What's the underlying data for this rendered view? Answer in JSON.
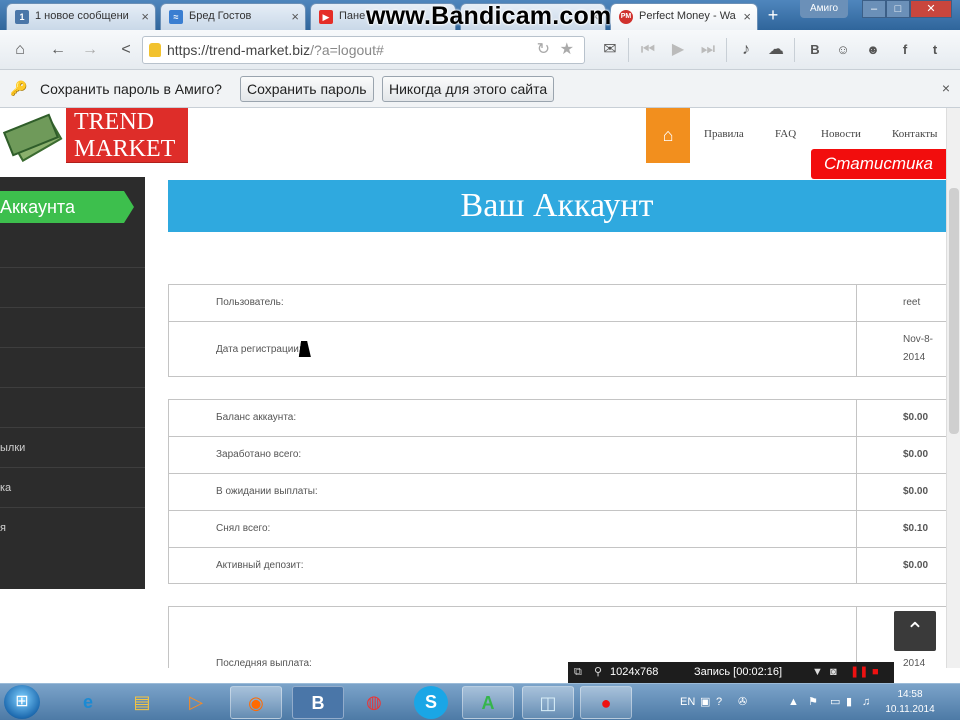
{
  "browser": {
    "tabs": [
      {
        "title": "1 новое сообщени",
        "favicon": "1",
        "color": "#4a76a8"
      },
      {
        "title": "Бред Гостов",
        "favicon": "≈",
        "color": "#3a7ed1"
      },
      {
        "title": "Пане",
        "favicon": "▶",
        "color": "#e52d27"
      },
      {
        "title": "",
        "favicon": "",
        "color": "#888888"
      },
      {
        "title": "Perfect Money - Wa",
        "favicon": "PM",
        "color": "#d0312d"
      }
    ],
    "new_tab_label": "+",
    "user_label": "Амиго",
    "watermark": "www.Bandicam.com",
    "url_host": "https://trend-market.biz",
    "url_path": "/?a=logout#"
  },
  "passbar": {
    "message": "Сохранить пароль в Амиго?",
    "save_label": "Сохранить пароль",
    "never_label": "Никогда для этого сайта",
    "close_label": "×"
  },
  "social_icons": [
    "В",
    "ОК",
    "ВКонтакте-друзья",
    "f",
    "twitter"
  ],
  "site": {
    "logo_line1": "TREND",
    "logo_line2": "MARKET",
    "menu": [
      "Правила",
      "FAQ",
      "Новости",
      "Контакты"
    ],
    "stat_button": "Статистика",
    "sidebar_title": "Аккаунта",
    "sidebar_items": [
      "",
      "",
      "",
      "",
      "ылки",
      "ка",
      "я"
    ],
    "page_title": "Ваш Аккаунт",
    "table1": [
      {
        "label": "Пользователь:",
        "value": "reet"
      },
      {
        "label": "Дата регистрации:",
        "value_line1": "Nov-8-",
        "value_line2": "2014"
      }
    ],
    "table2": [
      {
        "label": "Баланс аккаунта:",
        "value": "$0.00"
      },
      {
        "label": "Заработано всего:",
        "value": "$0.00"
      },
      {
        "label": "В ожидании выплаты:",
        "value": "$0.00"
      },
      {
        "label": "Снял всего:",
        "value": "$0.10"
      },
      {
        "label": "Активный депозит:",
        "value": "$0.00"
      }
    ],
    "table3": [
      {
        "label": "Последняя выплата:",
        "value": "2014"
      }
    ]
  },
  "recorder": {
    "resolution": "1024x768",
    "status": "Запись [00:02:16]"
  },
  "taskbar": {
    "apps": [
      "ie",
      "explorer",
      "media",
      "firefox",
      "В",
      "chrome",
      "S",
      "A",
      "notes",
      "record"
    ],
    "lang": "EN",
    "time": "14:58",
    "date": "10.11.2014"
  },
  "colors": {
    "accent_blue": "#2fa9df",
    "home_orange": "#f28f1e",
    "stat_red": "#f20d0d",
    "sidebar_green": "#3dbf4d",
    "logo_red": "#de2d29"
  }
}
